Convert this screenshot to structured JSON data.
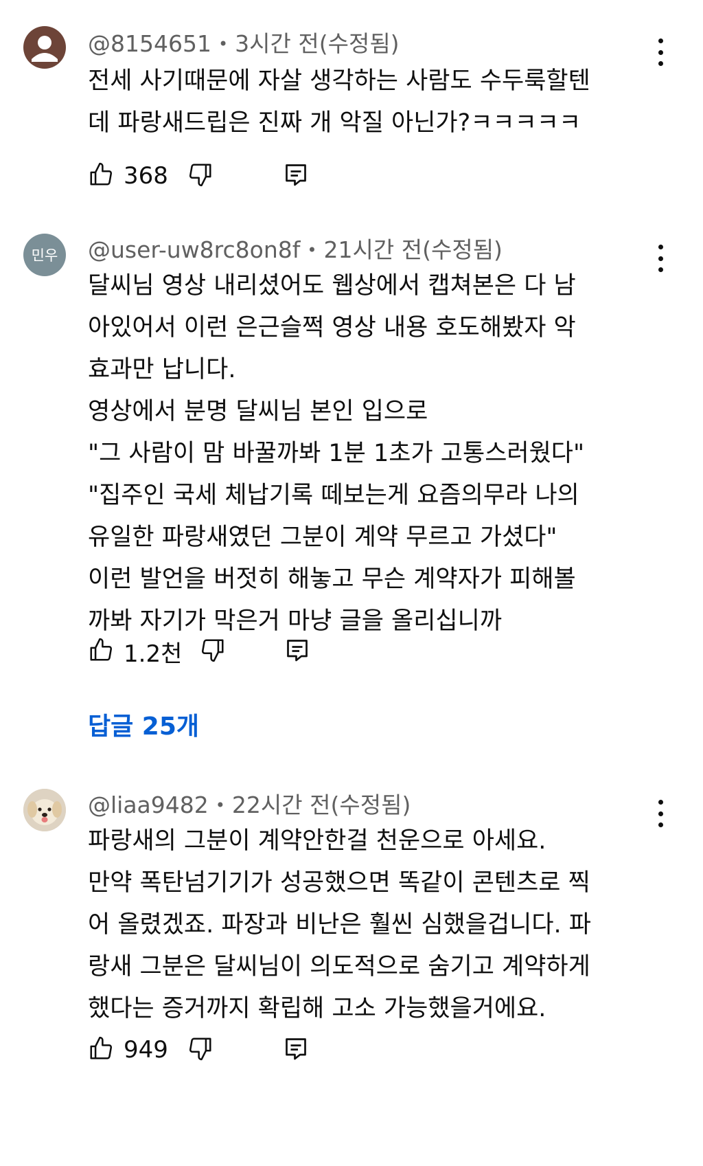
{
  "comments": [
    {
      "handle": "@8154651",
      "time": "3시간 전",
      "edited": "(수정됨)",
      "lines": [
        "전세 사기때문에 자살 생각하는 사람도 수두룩할텐",
        "데 파랑새드립은 진짜 개 악질 아닌가?ㅋㅋㅋㅋㅋ"
      ],
      "likes": "368",
      "avatar_color": "#6d4438"
    },
    {
      "handle": "@user-uw8rc8on8f",
      "time": "21시간 전",
      "edited": "(수정됨)",
      "avatar_text": "민우",
      "lines": [
        "달씨님 영상 내리셨어도 웹상에서 캡쳐본은 다 남",
        "아있어서 이런 은근슬쩍 영상 내용 호도해봤자 악",
        "효과만 납니다.",
        "영상에서 분명 달씨님 본인 입으로",
        "\"그 사람이 맘 바꿀까봐 1분 1초가 고통스러웠다\"",
        "\"집주인 국세 체납기록 떼보는게 요즘의무라 나의",
        "유일한 파랑새였던 그분이 계약 무르고 가셨다\"",
        "이런 발언을 버젓히 해놓고 무슨 계약자가 피해볼",
        "까봐 자기가 막은거 마냥 글을 올리십니까"
      ],
      "likes": "1.2천",
      "replies": "답글 25개",
      "avatar_color": "#7b8f97"
    },
    {
      "handle": "@liaa9482",
      "time": "22시간 전",
      "edited": "(수정됨)",
      "lines": [
        "파랑새의 그분이 계약안한걸 천운으로 아세요.",
        "만약 폭탄넘기기가 성공했으면 똑같이 콘텐츠로 찍",
        "어 올렸겠죠. 파장과 비난은 훨씬 심했을겁니다. 파",
        "랑새 그분은 달씨님이 의도적으로 숨기고 계약하게",
        "했다는 증거까지 확립해 고소 가능했을거에요."
      ],
      "likes": "949",
      "avatar_color": "#e6dccd"
    }
  ],
  "icons": {
    "like": "thumb-up-icon",
    "dislike": "thumb-down-icon",
    "reply": "comment-reply-icon",
    "menu": "more-vertical-icon"
  },
  "colors": {
    "reply_link": "#065fd4",
    "meta": "#606060"
  }
}
